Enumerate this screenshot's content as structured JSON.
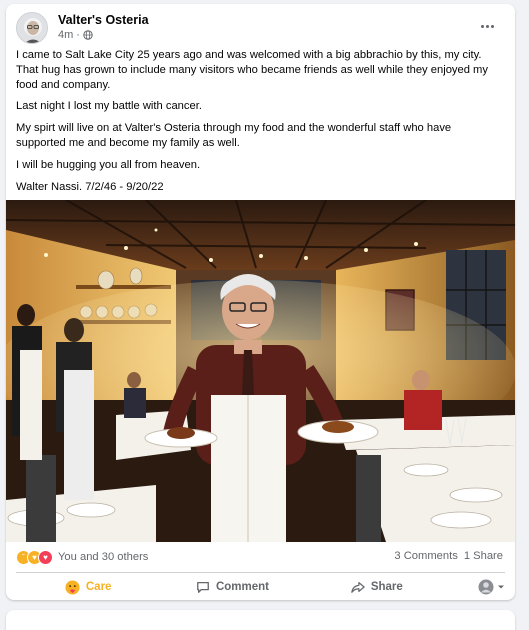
{
  "post": {
    "page_name": "Valter's Osteria",
    "time": "4m",
    "privacy_icon": "globe-icon",
    "paragraphs": [
      "I came to Salt Lake City 25 years ago and was welcomed with a big abbrachio by this, my city. That hug has grown to include many visitors who became friends as well while they enjoyed my food and company.",
      "Last night I lost my battle with cancer.",
      "My spirt will live on at Valter's Osteria through my food and the wonderful staff who have supported me and become my family as well.",
      "I will be hugging you all from heaven.",
      "Walter Nassi. 7/2/46 - 9/20/22"
    ]
  },
  "reactions": {
    "emojis": [
      "sad-reaction-icon",
      "care-reaction-icon",
      "love-reaction-icon"
    ],
    "summary": "You and 30 others",
    "comments": "3 Comments",
    "shares": "1 Share"
  },
  "actions": {
    "care": "Care",
    "comment": "Comment",
    "share": "Share"
  },
  "colors": {
    "care": "#f7b125",
    "love": "#f33e58",
    "muted": "#65676b"
  }
}
